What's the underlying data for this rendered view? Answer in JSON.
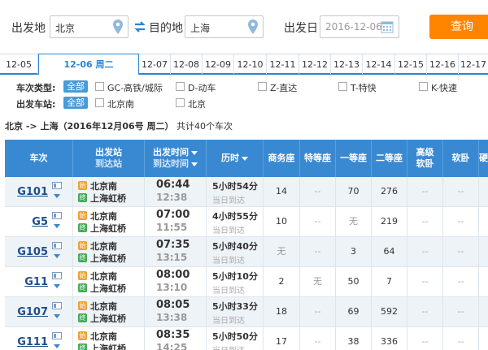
{
  "search": {
    "from_label": "出发地",
    "from_value": "北京",
    "to_label": "目的地",
    "to_value": "上海",
    "date_label": "出发日",
    "date_value": "2016-12-06",
    "query_label": "查询"
  },
  "date_tabs": [
    {
      "label": "12-05",
      "active": false
    },
    {
      "label": "12-06 周二",
      "active": true
    },
    {
      "label": "12-07",
      "active": false
    },
    {
      "label": "12-08",
      "active": false
    },
    {
      "label": "12-09",
      "active": false
    },
    {
      "label": "12-10",
      "active": false
    },
    {
      "label": "12-11",
      "active": false
    },
    {
      "label": "12-12",
      "active": false
    },
    {
      "label": "12-13",
      "active": false
    },
    {
      "label": "12-14",
      "active": false
    },
    {
      "label": "12-15",
      "active": false
    },
    {
      "label": "12-16",
      "active": false
    },
    {
      "label": "12-17",
      "active": false
    }
  ],
  "filters": {
    "type_label": "车次类型:",
    "type_all": "全部",
    "types": [
      "GC-高铁/城际",
      "D-动车",
      "Z-直达",
      "T-特快",
      "K-快速"
    ],
    "station_label": "出发车站:",
    "station_all": "全部",
    "stations": [
      "北京南",
      "北京"
    ]
  },
  "summary": {
    "route": "北京 -> 上海",
    "date": "（2016年12月06号  周二）",
    "count": "共计40个车次"
  },
  "table": {
    "headers": {
      "train": "车次",
      "station_top": "出发站",
      "station_bottom": "到达站",
      "time_top": "出发时间",
      "time_bottom": "到达时间",
      "duration": "历时",
      "business": "商务座",
      "special": "特等座",
      "first": "一等座",
      "second": "二等座",
      "soft_top": "高级",
      "soft_bottom": "软卧",
      "softsleeper": "软卧",
      "hard": "硬"
    },
    "badge_start": "始",
    "badge_end": "终",
    "rows": [
      {
        "train": "G101",
        "from": "北京南",
        "to": "上海虹桥",
        "dep": "06:44",
        "arr": "12:38",
        "dur": "5小时54分",
        "day": "当日到达",
        "business": "14",
        "special": "--",
        "first": "70",
        "second": "276",
        "soft": "--",
        "softsleeper": "--"
      },
      {
        "train": "G5",
        "from": "北京南",
        "to": "上海虹桥",
        "dep": "07:00",
        "arr": "11:55",
        "dur": "4小时55分",
        "day": "当日到达",
        "business": "10",
        "special": "--",
        "first": "无",
        "second": "219",
        "soft": "--",
        "softsleeper": "--"
      },
      {
        "train": "G105",
        "from": "北京南",
        "to": "上海虹桥",
        "dep": "07:35",
        "arr": "13:15",
        "dur": "5小时40分",
        "day": "当日到达",
        "business": "无",
        "special": "--",
        "first": "3",
        "second": "64",
        "soft": "--",
        "softsleeper": "--"
      },
      {
        "train": "G11",
        "from": "北京南",
        "to": "上海虹桥",
        "dep": "08:00",
        "arr": "13:10",
        "dur": "5小时10分",
        "day": "当日到达",
        "business": "2",
        "special": "无",
        "first": "50",
        "second": "7",
        "soft": "--",
        "softsleeper": "--"
      },
      {
        "train": "G107",
        "from": "北京南",
        "to": "上海虹桥",
        "dep": "08:05",
        "arr": "13:38",
        "dur": "5小时33分",
        "day": "当日到达",
        "business": "18",
        "special": "--",
        "first": "69",
        "second": "592",
        "soft": "--",
        "softsleeper": "--"
      },
      {
        "train": "G111",
        "from": "北京南",
        "to": "上海虹桥",
        "dep": "08:35",
        "arr": "14:25",
        "dur": "5小时50分",
        "day": "当日到达",
        "business": "17",
        "special": "--",
        "first": "38",
        "second": "336",
        "soft": "--",
        "softsleeper": "--"
      }
    ]
  }
}
